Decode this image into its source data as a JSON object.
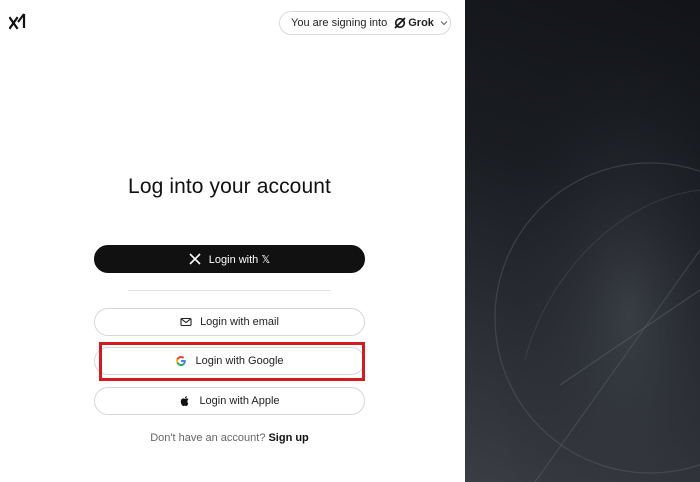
{
  "header": {
    "logo_icon": "xai-logo-icon",
    "signing_prefix": "You are signing into",
    "product_icon": "grok-icon",
    "product_name": "Grok",
    "dropdown_icon": "chevron-down-icon"
  },
  "main": {
    "title": "Log into your account",
    "buttons": {
      "x_label": "Login with 𝕏",
      "email_label": "Login with email",
      "google_label": "Login with Google",
      "apple_label": "Login with Apple"
    },
    "signup_prompt": "Don't have an account?",
    "signup_link": "Sign up"
  },
  "colors": {
    "primary_button": "#111111",
    "highlight_border": "#d41a1f",
    "side_panel": "#1a1d22"
  }
}
